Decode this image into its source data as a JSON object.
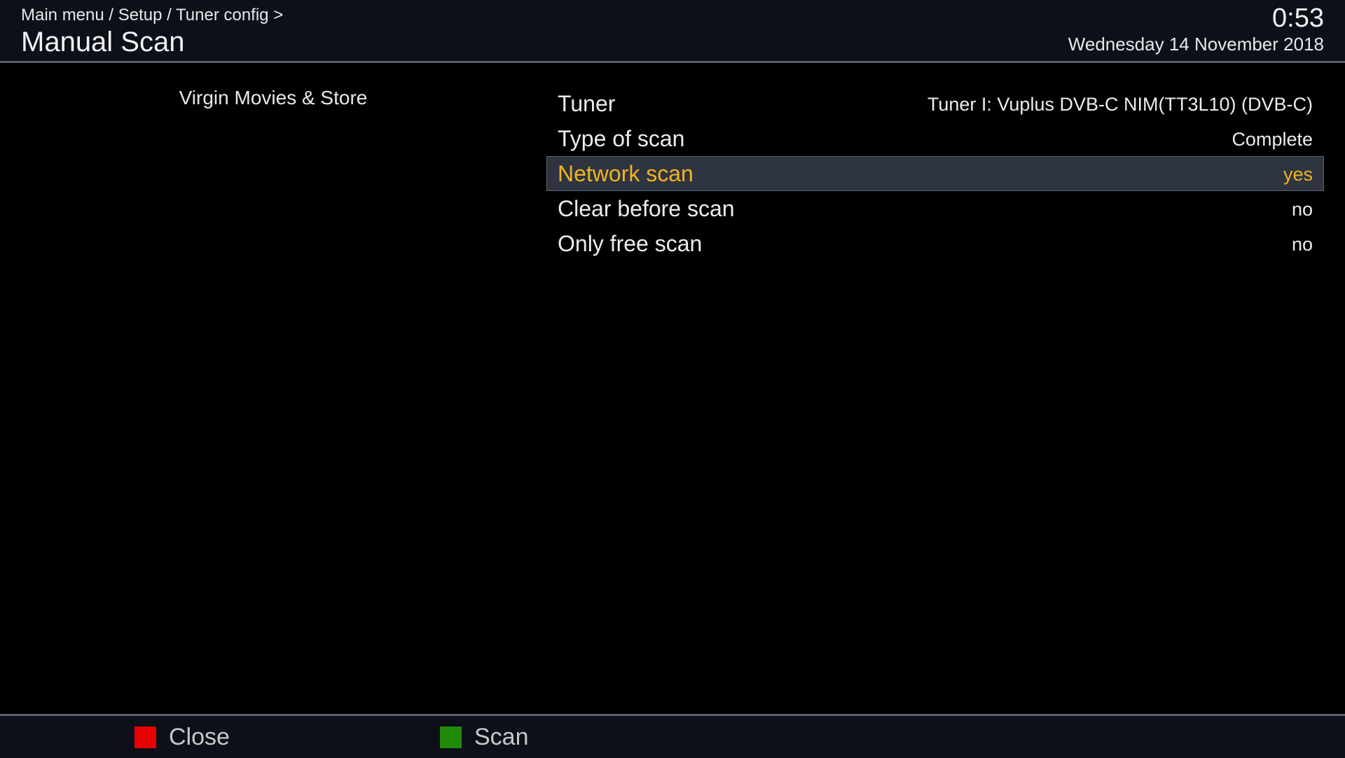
{
  "header": {
    "breadcrumb": "Main menu / Setup / Tuner config >",
    "title": "Manual Scan",
    "clock": "0:53",
    "date": "Wednesday 14 November 2018"
  },
  "info": {
    "service_name": "Virgin Movies & Store"
  },
  "config": {
    "rows": [
      {
        "label": "Tuner",
        "value": "Tuner I: Vuplus DVB-C NIM(TT3L10) (DVB-C)"
      },
      {
        "label": "Type of scan",
        "value": "Complete"
      },
      {
        "label": "Network scan",
        "value": "yes"
      },
      {
        "label": "Clear before scan",
        "value": "no"
      },
      {
        "label": "Only free scan",
        "value": "no"
      }
    ],
    "selected_index": 2
  },
  "footer": {
    "buttons": [
      {
        "label": "Close",
        "color": "#e60000",
        "icon": "red-key-icon"
      },
      {
        "label": "Scan",
        "color": "#1f8a0a",
        "icon": "green-key-icon"
      }
    ]
  },
  "colors": {
    "highlight_text": "#f0b420",
    "selection_bg": "#2f3441",
    "header_bg": "#0d1019"
  }
}
